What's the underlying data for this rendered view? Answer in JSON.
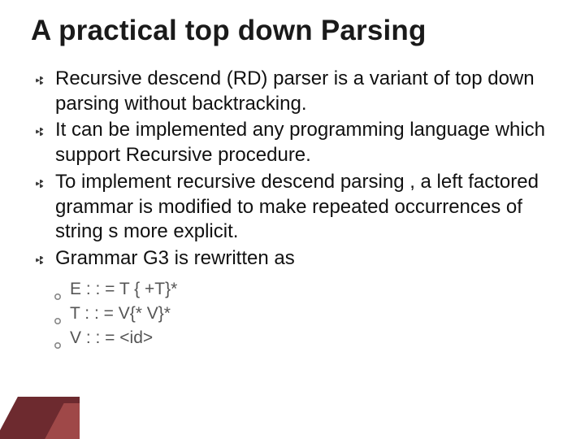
{
  "title": "A practical top down Parsing",
  "bullets": [
    "Recursive descend (RD) parser is a variant of top down parsing without backtracking.",
    "It can be implemented any programming language which support Recursive procedure.",
    "To implement recursive descend parsing , a left factored grammar is modified to make repeated occurrences of string s more explicit.",
    "Grammar G3 is rewritten as"
  ],
  "sub_bullets": [
    "E : : = T { +T}*",
    "T : : = V{* V}*",
    "V : : = <id>"
  ],
  "icons": {
    "main_bullet": "pinwheel-icon",
    "sub_bullet": "ring-icon"
  }
}
